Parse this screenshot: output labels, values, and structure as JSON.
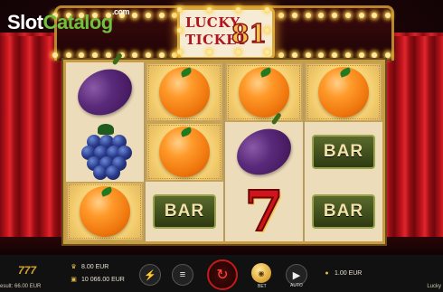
{
  "watermark": {
    "part1": "Slot",
    "part2": "Catalog",
    "part3": ".com"
  },
  "game_logo": {
    "line1": "LUCKY",
    "line2": "TICKET",
    "number": "81"
  },
  "reels": [
    [
      "plum",
      "grapes",
      "orange"
    ],
    [
      "orange",
      "orange",
      "bar"
    ],
    [
      "orange",
      "plum",
      "seven"
    ],
    [
      "orange",
      "bar",
      "bar"
    ]
  ],
  "highlighted": [
    [
      false,
      false,
      true
    ],
    [
      true,
      true,
      false
    ],
    [
      true,
      false,
      false
    ],
    [
      true,
      false,
      false
    ]
  ],
  "symbol_text": {
    "bar": "BAR",
    "seven": "7"
  },
  "hud": {
    "provider": "777",
    "last_result": "esult: 66.00 EUR",
    "win": "8.00 EUR",
    "balance": "10 066.00 EUR",
    "bet_amount": "1.00 EUR",
    "bet_label": "BET",
    "auto_label": "AUTO",
    "corner": "Lucky"
  },
  "icons": {
    "win": "trophy-icon",
    "balance": "wallet-icon",
    "bet_amount": "coins-icon",
    "turbo": "lightning-icon",
    "menu": "menu-icon",
    "spin": "spin-icon",
    "bet": "coin-stack-icon",
    "auto": "autoplay-icon"
  },
  "colors": {
    "accent": "#c41a1a",
    "gold": "#d9a230",
    "brand_green": "#6fc23b"
  }
}
